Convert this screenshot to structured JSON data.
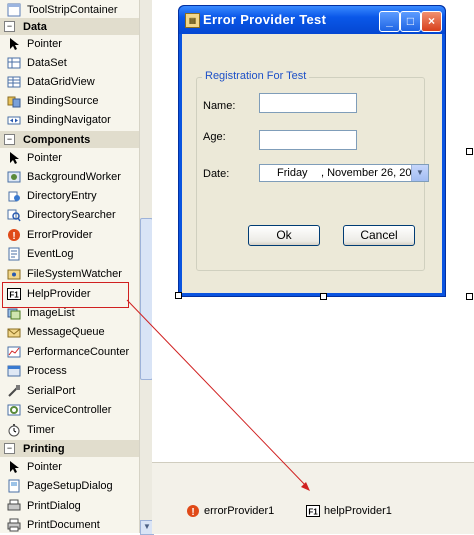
{
  "toolbox": {
    "top_item": "ToolStripContainer",
    "categories": {
      "data": "Data",
      "components": "Components",
      "printing": "Printing"
    },
    "data_items": [
      "Pointer",
      "DataSet",
      "DataGridView",
      "BindingSource",
      "BindingNavigator"
    ],
    "component_items": [
      "Pointer",
      "BackgroundWorker",
      "DirectoryEntry",
      "DirectorySearcher",
      "ErrorProvider",
      "EventLog",
      "FileSystemWatcher",
      "HelpProvider",
      "ImageList",
      "MessageQueue",
      "PerformanceCounter",
      "Process",
      "SerialPort",
      "ServiceController",
      "Timer"
    ],
    "printing_items": [
      "Pointer",
      "PageSetupDialog",
      "PrintDialog",
      "PrintDocument"
    ],
    "help_icon_text": "F1"
  },
  "form": {
    "title": "Error Provider Test",
    "group_title": "Registration For Test",
    "name_label": "Name:",
    "age_label": "Age:",
    "date_label": "Date:",
    "name_value": "",
    "age_value": "",
    "date_day": "Friday",
    "date_rest": ", November 26, 20",
    "ok_label": "Ok",
    "cancel_label": "Cancel"
  },
  "tray": {
    "error_provider": "errorProvider1",
    "help_provider": "helpProvider1",
    "help_icon_text": "F1"
  },
  "colors": {
    "title_bar": "#0a57e8",
    "highlight": "#d02020",
    "group_title": "#1d50c8"
  }
}
